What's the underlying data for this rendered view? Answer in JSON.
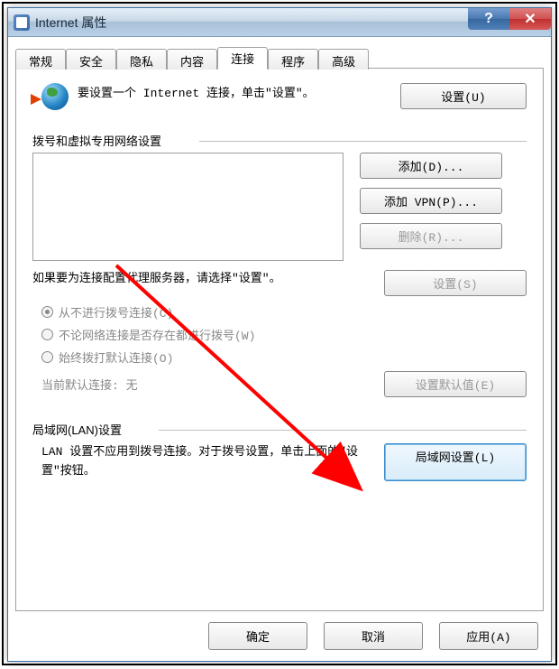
{
  "window": {
    "title": "Internet 属性"
  },
  "tabs": {
    "general": "常规",
    "security": "安全",
    "privacy": "隐私",
    "content": "内容",
    "connections": "连接",
    "programs": "程序",
    "advanced": "高级"
  },
  "top": {
    "instruction": "要设置一个 Internet 连接，单击\"设置\"。",
    "setup_btn": "设置(U)"
  },
  "dialup": {
    "header": "拨号和虚拟专用网络设置",
    "add_btn": "添加(D)...",
    "add_vpn_btn": "添加 VPN(P)...",
    "remove_btn": "删除(R)...",
    "proxy_text": "如果要为连接配置代理服务器，请选择\"设置\"。",
    "settings_btn": "设置(S)",
    "radio_never": "从不进行拨号连接(C)",
    "radio_notpresent": "不论网络连接是否存在都进行拨号(W)",
    "radio_always": "始终拨打默认连接(O)",
    "default_label": "当前默认连接: 无",
    "set_default_btn": "设置默认值(E)"
  },
  "lan": {
    "header": "局域网(LAN)设置",
    "text": "LAN 设置不应用到拨号连接。对于拨号设置，单击上面的\"设置\"按钮。",
    "btn": "局域网设置(L)"
  },
  "footer": {
    "ok": "确定",
    "cancel": "取消",
    "apply": "应用(A)"
  }
}
